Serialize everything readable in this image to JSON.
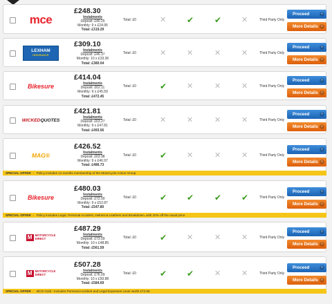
{
  "colors": {
    "proceed": "#1c64b4",
    "more": "#dd5f0d",
    "offer": "#f5c518",
    "tick": "#3a9a1c",
    "cross": "#b9b9b9"
  },
  "labels": {
    "instalments": "Instalments",
    "proceed": "Proceed",
    "more_details": "More Details",
    "special_offer": "SPECIAL OFFER",
    "offer_sep": "-"
  },
  "quotes": [
    {
      "insurer": "mce",
      "price": "£248.30",
      "deposit": "Deposit: £40.25",
      "monthly": "Monthly: 9 x £24.95",
      "total_inst": "Total: £319.29",
      "total": "Total: £0",
      "checks": [
        "cross",
        "tick",
        "tick",
        "cross"
      ],
      "third_party": "Third Party Only",
      "offer": ""
    },
    {
      "insurer": "Lexham Insurance",
      "logo_l1": "LEXHAM",
      "logo_l2": "INSURANCE",
      "price": "£309.10",
      "deposit": "Deposit: £46.37",
      "monthly": "Monthly: 10 x £33.36",
      "total_inst": "Total: £380.04",
      "total": "Total: £0",
      "checks": [
        "cross",
        "cross",
        "cross",
        "cross"
      ],
      "third_party": "Third Party Only",
      "offer": ""
    },
    {
      "insurer": "Bikesure",
      "price": "£414.04",
      "deposit": "Deposit: £62.11",
      "monthly": "Monthly: 9 x £45.59",
      "total_inst": "Total: £472.45",
      "total": "Total: £0",
      "checks": [
        "tick",
        "cross",
        "cross",
        "cross"
      ],
      "third_party": "Third Party Only",
      "offer": ""
    },
    {
      "insurer": "Wicked Quotes",
      "logo_a": "WICKED",
      "logo_b": "QUOTES",
      "price": "£421.81",
      "deposit": "Deposit: £63.27",
      "monthly": "Monthly: 9 x £47.81",
      "total_inst": "Total: £493.56",
      "total": "Total: £0",
      "checks": [
        "cross",
        "cross",
        "cross",
        "cross"
      ],
      "third_party": "Third Party Only",
      "offer": ""
    },
    {
      "insurer": "MAG",
      "logo_a": "MAG",
      "logo_b": "®",
      "price": "£426.52",
      "deposit": "Deposit: £63.98",
      "monthly": "Monthly: 9 x £46.97",
      "total_inst": "Total: £486.73",
      "total": "Total: £0",
      "checks": [
        "tick",
        "cross",
        "cross",
        "cross"
      ],
      "third_party": "Third Party Only",
      "offer": "Policy includes 12 months membership of the Motorcycle Action Group"
    },
    {
      "insurer": "Bikesure",
      "price": "£480.03",
      "deposit": "Deposit: £72.00",
      "monthly": "Monthly: 9 x £52.87",
      "total_inst": "Total: £547.80",
      "total": "Total: £0",
      "checks": [
        "tick",
        "tick",
        "tick",
        "tick"
      ],
      "third_party": "Third Party Only",
      "offer": "Policy includes Legal, Personal Accident, Helmet & Leathers and Breakdown, with 20% off the usual price"
    },
    {
      "insurer": "Motorcycle Direct",
      "logo_l1": "MOTORCYCLE",
      "logo_l2": "DIRECT",
      "price": "£487.29",
      "deposit": "Deposit: £73.09",
      "monthly": "Monthly: 10 x £48.85",
      "total_inst": "Total: £561.59",
      "total": "Total: £0",
      "checks": [
        "tick",
        "cross",
        "cross",
        "cross"
      ],
      "third_party": "Third Party Only",
      "offer": ""
    },
    {
      "insurer": "Motorcycle Direct",
      "logo_l1": "MOTORCYCLE",
      "logo_l2": "DIRECT",
      "price": "£507.28",
      "deposit": "Deposit: £76.09",
      "monthly": "Monthly: 10 x £50.88",
      "total_inst": "Total: £584.69",
      "total": "Total: £0",
      "checks": [
        "tick",
        "tick",
        "cross",
        "cross"
      ],
      "third_party": "Third Party Only",
      "offer": "MCD Gold - Includes Personal Accident and Legal Expenses cover worth £72.96"
    }
  ]
}
